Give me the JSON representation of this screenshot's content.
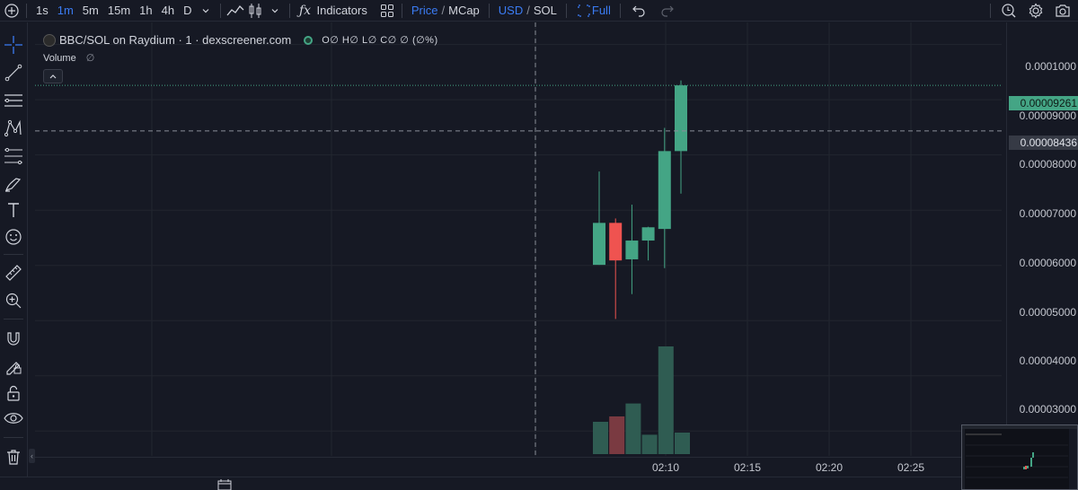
{
  "toolbar": {
    "intervals": [
      "1s",
      "1m",
      "5m",
      "15m",
      "1h",
      "4h",
      "D"
    ],
    "active_interval": "1m",
    "indicators_label": "Indicators",
    "price_label": "Price",
    "mcap_label": "MCap",
    "slash": "/",
    "usd_label": "USD",
    "sol_label": "SOL",
    "full_label": "Full",
    "accent": "#3b7cf4"
  },
  "left_tools": [
    "crosshair-icon",
    "trend-line-icon",
    "horizontal-lines-icon",
    "pattern-icon",
    "fib-icon",
    "brush-icon",
    "text-icon",
    "emoji-icon",
    "ruler-icon",
    "zoom-in-icon",
    "magnet-icon",
    "lock-drawing-icon",
    "lock-icon",
    "eye-icon",
    "trash-icon"
  ],
  "legend": {
    "title": "BBC/SOL on Raydium · 1 · dexscreener.com",
    "ohlc": "O∅ H∅ L∅ C∅ ∅ (∅%)",
    "volume_label": "Volume",
    "volume_value": "∅"
  },
  "price_axis": {
    "ticks": [
      "0.0001000",
      "0.00009000",
      "0.00008000",
      "0.00007000",
      "0.00006000",
      "0.00005000",
      "0.00004000",
      "0.00003000"
    ],
    "last_price": "0.00009261",
    "crosshair_price": "0.00008436",
    "up_color": "#44a585",
    "down_color": "#ef5350"
  },
  "time_axis": {
    "ticks": [
      "02:10",
      "02:15",
      "02:20",
      "02:25"
    ]
  },
  "chart_data": {
    "type": "candlestick",
    "ylim": [
      2.55e-05,
      0.000104
    ],
    "candles": [
      {
        "o": 6.01e-05,
        "h": 7.7e-05,
        "l": 6.01e-05,
        "c": 6.77e-05
      },
      {
        "o": 6.77e-05,
        "h": 6.85e-05,
        "l": 5.03e-05,
        "c": 6.09e-05
      },
      {
        "o": 6.11e-05,
        "h": 7.1e-05,
        "l": 5.48e-05,
        "c": 6.45e-05
      },
      {
        "o": 6.45e-05,
        "h": 6.7e-05,
        "l": 6.09e-05,
        "c": 6.69e-05
      },
      {
        "o": 6.66e-05,
        "h": 8.49e-05,
        "l": 5.95e-05,
        "c": 8.07e-05
      },
      {
        "o": 8.07e-05,
        "h": 9.35e-05,
        "l": 7.3e-05,
        "c": 9.26e-05
      }
    ],
    "volumes": [
      0.3,
      0.35,
      0.47,
      0.18,
      1.0,
      0.2
    ],
    "volume_colors": [
      "#2f5c52",
      "#7a3a41",
      "#2f5c52",
      "#2f5c52",
      "#2f5c52",
      "#2f5c52"
    ]
  }
}
